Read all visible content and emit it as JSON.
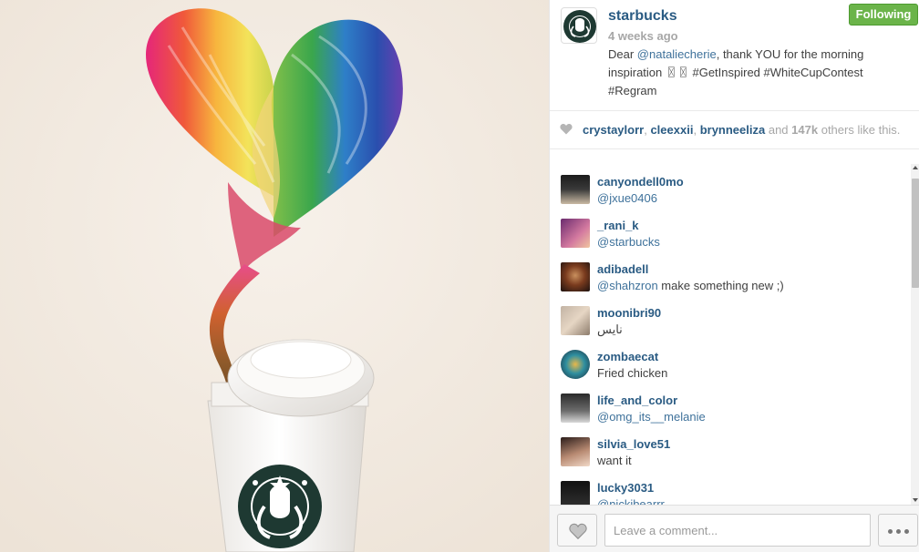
{
  "post": {
    "username": "starbucks",
    "timestamp": "4 weeks ago",
    "follow_label": "Following",
    "caption": {
      "prefix": "Dear ",
      "mention": "@nataliecherie",
      "line1_rest": ", thank YOU for the morning",
      "line2": "inspiration 〿〿 #GetInspired #WhiteCupContest",
      "line3": "#Regram"
    }
  },
  "likes": {
    "users": [
      "crystaylorr",
      "cleexxii",
      "brynneeliza"
    ],
    "and": "and",
    "count": "147k",
    "suffix": "others like this."
  },
  "comments": [
    {
      "user": "canyondell0mo",
      "text": "@jxue0406",
      "is_mention": true
    },
    {
      "user": "_rani_k",
      "text": "@starbucks",
      "is_mention": true
    },
    {
      "user": "adibadell",
      "mention": "@shahzron",
      "text": " make something new ;)"
    },
    {
      "user": "moonibri90",
      "text": "نايس"
    },
    {
      "user": "zombaecat",
      "text": "Fried chicken"
    },
    {
      "user": "life_and_color",
      "text": "@omg_its__melanie",
      "is_mention": true
    },
    {
      "user": "silvia_love51",
      "text": "want it"
    },
    {
      "user": "lucky3031",
      "text": "@nickibearrr",
      "is_mention": true
    }
  ],
  "footer": {
    "comment_placeholder": "Leave a comment..."
  },
  "colors": {
    "username_blue": "#2a5b83",
    "link_blue": "#3f729b",
    "follow_green": "#6bb44a",
    "muted_gray": "#a7a7a7"
  },
  "icons": {
    "like": "heart-icon",
    "more": "ellipsis-icon",
    "logo": "starbucks-siren-logo"
  }
}
